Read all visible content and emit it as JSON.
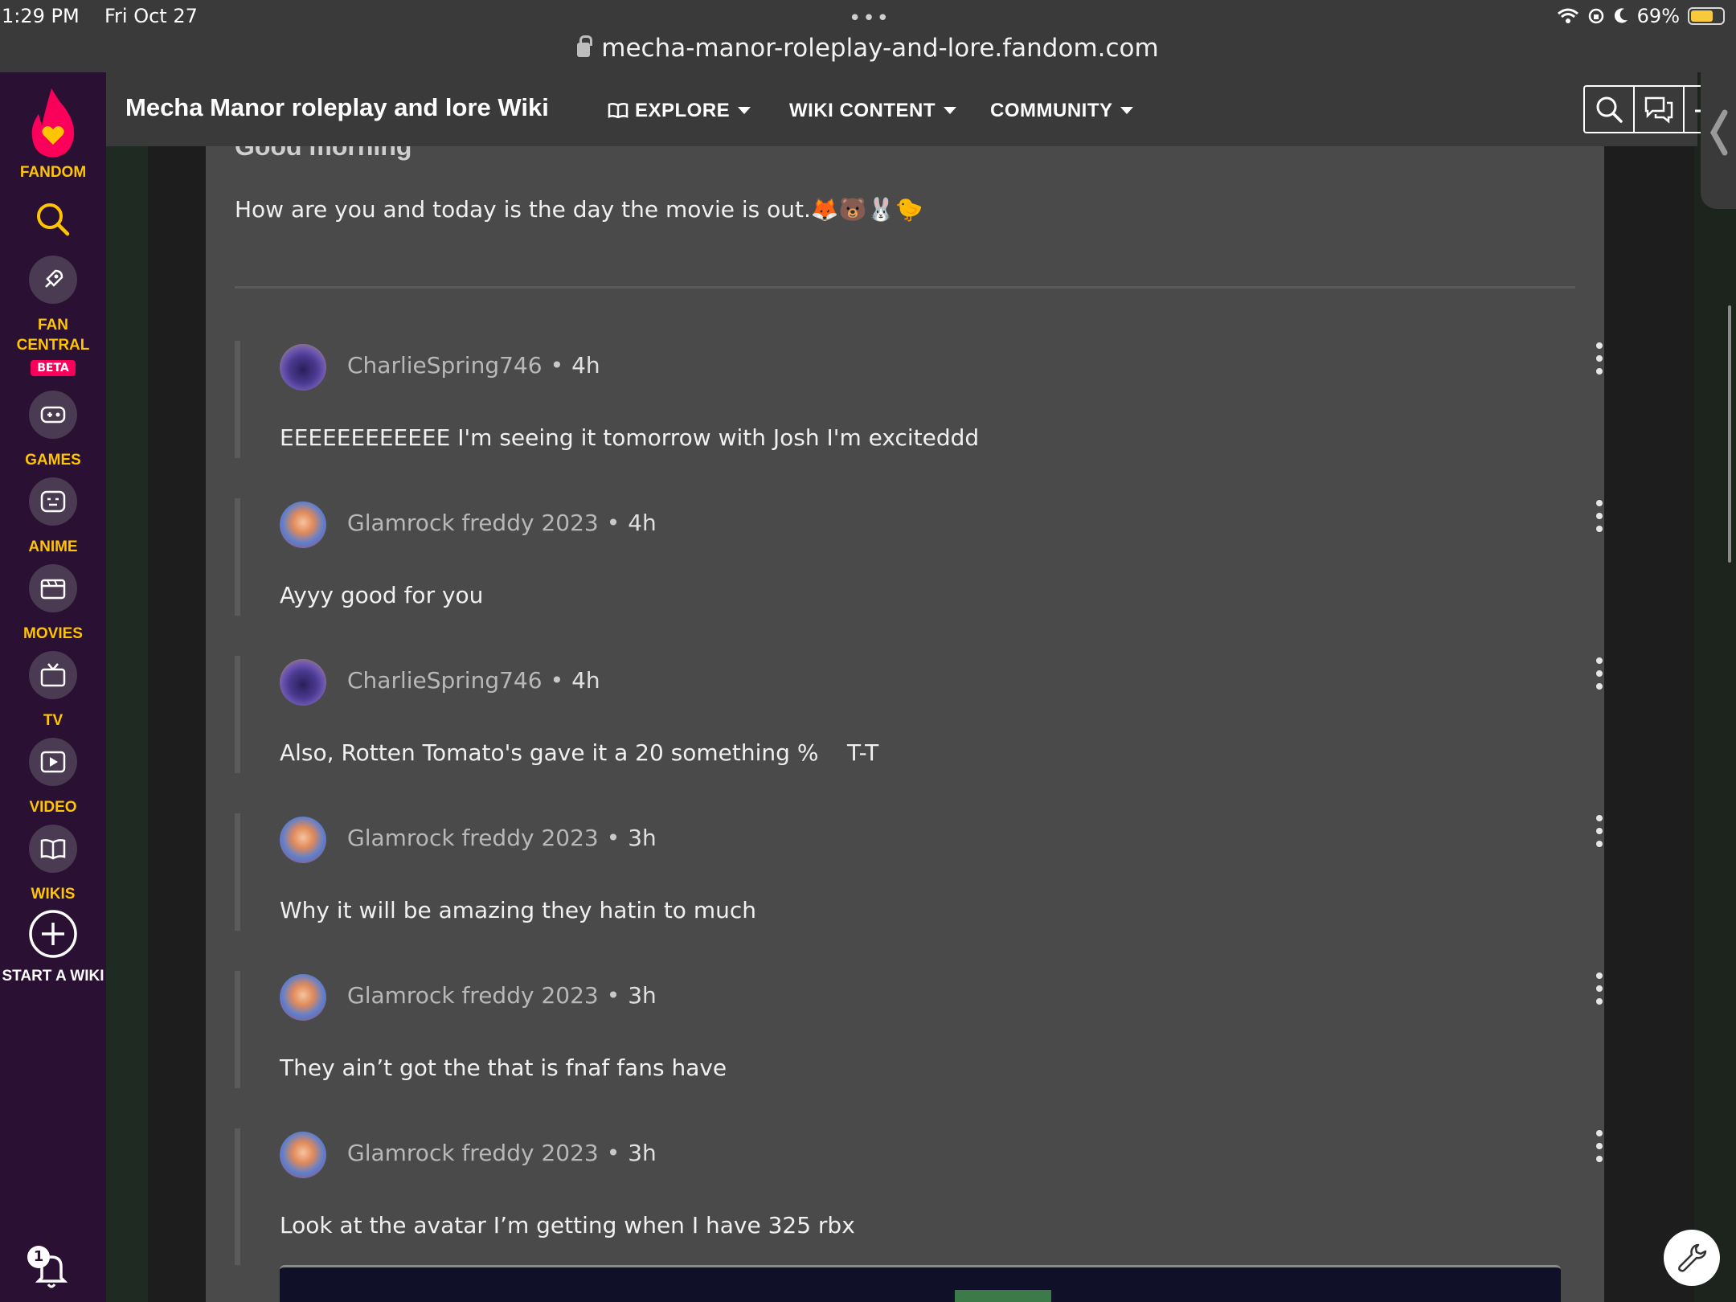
{
  "status_bar": {
    "time": "1:29 PM",
    "date": "Fri Oct 27",
    "battery": "69%",
    "url": "mecha-manor-roleplay-and-lore.fandom.com"
  },
  "sidebar": {
    "brand": "FANDOM",
    "items": [
      {
        "label": "FAN CENTRAL",
        "icon": "rocket-icon",
        "badge": "BETA"
      },
      {
        "label": "GAMES",
        "icon": "controller-icon"
      },
      {
        "label": "ANIME",
        "icon": "anime-face-icon"
      },
      {
        "label": "MOVIES",
        "icon": "clapperboard-icon"
      },
      {
        "label": "TV",
        "icon": "tv-icon"
      },
      {
        "label": "VIDEO",
        "icon": "play-icon"
      },
      {
        "label": "WIKIS",
        "icon": "book-icon"
      },
      {
        "label": "START A WIKI",
        "icon": "plus-icon"
      }
    ],
    "notification_count": "1"
  },
  "header": {
    "wiki_title": "Mecha Manor roleplay and lore Wiki",
    "nav": [
      {
        "label": "EXPLORE"
      },
      {
        "label": "WIKI CONTENT"
      },
      {
        "label": "COMMUNITY"
      }
    ]
  },
  "post": {
    "title": "Good morning",
    "body": "How are you and today is the day the movie is out.🦊🐻🐰🐤"
  },
  "replies": [
    {
      "author": "CharlieSpring746",
      "ago": "4h",
      "text": "EEEEEEEEEEEE I'm seeing it tomorrow with Josh I'm exciteddd"
    },
    {
      "author": "Glamrock freddy 2023",
      "ago": "4h",
      "text": "Ayyy good for you"
    },
    {
      "author": "CharlieSpring746",
      "ago": "4h",
      "text": "Also, Rotten Tomato's gave it a 20 something %    T-T"
    },
    {
      "author": "Glamrock freddy 2023",
      "ago": "3h",
      "text": "Why it will be amazing they hatin to much"
    },
    {
      "author": "Glamrock freddy 2023",
      "ago": "3h",
      "text": "They ain’t got the that is fnaf fans have"
    },
    {
      "author": "Glamrock freddy 2023",
      "ago": "3h",
      "text": "Look at the avatar I’m getting when I have 325 rbx"
    }
  ],
  "separator": "•",
  "colors": {
    "fandom_yellow": "#ffc500",
    "fandom_pink": "#fa005a",
    "sidebar_bg": "#2a1032",
    "content_bg": "#4a4a4a"
  }
}
